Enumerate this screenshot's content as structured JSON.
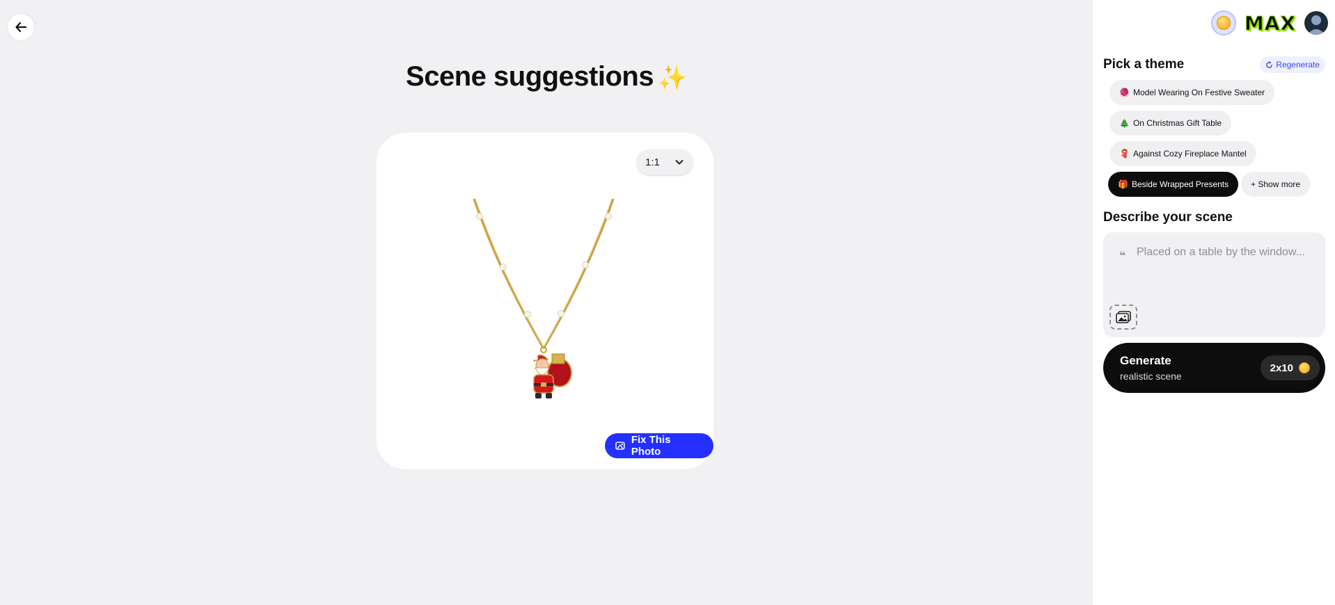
{
  "main": {
    "title": "Scene suggestions",
    "title_emoji": "✨",
    "ratio": {
      "value": "1:1"
    },
    "fix_button": {
      "label": "Fix This Photo"
    }
  },
  "panel": {
    "logo_text": "MAX",
    "pick_theme": {
      "title": "Pick a theme",
      "regenerate_label": "Regenerate",
      "themes": [
        {
          "emoji": "🧶",
          "label": "Model Wearing On Festive Sweater",
          "selected": false
        },
        {
          "emoji": "🎄",
          "label": "On Christmas Gift Table",
          "selected": false
        },
        {
          "emoji": "🧣",
          "label": "Against Cozy Fireplace Mantel",
          "selected": false
        },
        {
          "emoji": "🎁",
          "label": "Beside Wrapped Presents",
          "selected": true
        }
      ],
      "show_more_label": "+ Show more"
    },
    "describe": {
      "title": "Describe your scene",
      "placeholder": "Placed on a table by the window..."
    },
    "generate": {
      "title": "Generate",
      "subtitle": "realistic scene",
      "cost": "2x10"
    }
  },
  "colors": {
    "accent": "#2430ff",
    "background": "#f1f1f3",
    "panel": "#ffffff",
    "dark_button": "#0d0d0d",
    "logo_outline": "#8fe000"
  }
}
